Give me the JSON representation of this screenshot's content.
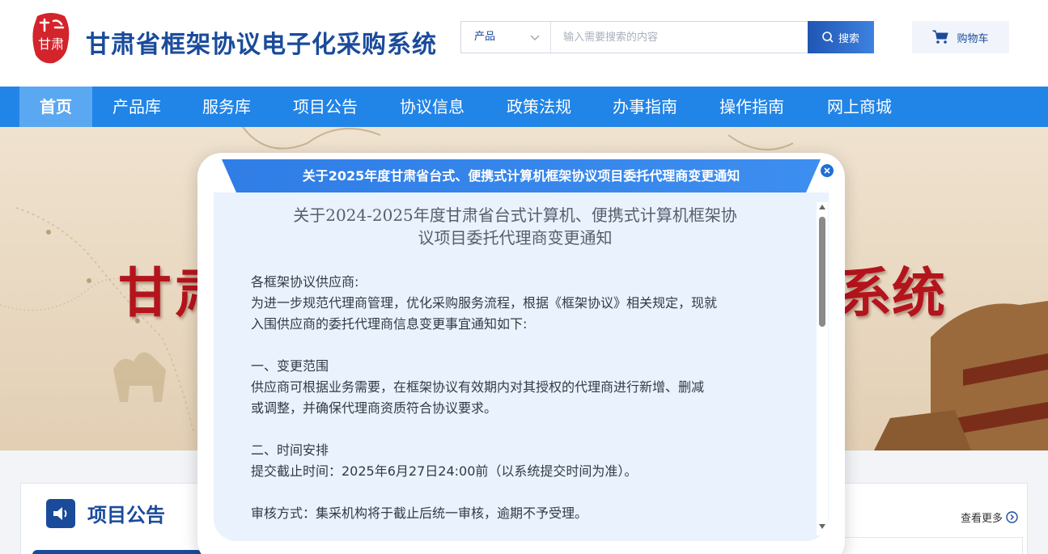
{
  "header": {
    "logo_text": "甘肃",
    "site_title": "甘肃省框架协议电子化采购系统",
    "search": {
      "category": "产品",
      "placeholder": "输入需要搜索的内容",
      "button_label": "搜索"
    },
    "cart_label": "购物车"
  },
  "nav": {
    "items": [
      {
        "label": "首页",
        "active": true
      },
      {
        "label": "产品库"
      },
      {
        "label": "服务库"
      },
      {
        "label": "项目公告"
      },
      {
        "label": "协议信息"
      },
      {
        "label": "政策法规"
      },
      {
        "label": "办事指南"
      },
      {
        "label": "操作指南"
      },
      {
        "label": "网上商城"
      }
    ]
  },
  "banner": {
    "title_left": "甘肃",
    "title_right": "系统"
  },
  "modal": {
    "header_title": "关于2025年度甘肃省台式、便携式计算机框架协议项目委托代理商变更通知",
    "doc_title_line1": "关于2024-2025年度甘肃省台式计算机、便携式计算机框架协",
    "doc_title_line2": "议项目委托代理商变更通知",
    "paragraphs": [
      "各框架协议供应商:",
      "为进一步规范代理商管理，优化采购服务流程，根据《框架协议》相关规定，现就",
      "入围供应商的委托代理商信息变更事宜通知如下:",
      "一、变更范围",
      " 供应商可根据业务需要，在框架协议有效期内对其授权的代理商进行新增、删减",
      "或调整，并确保代理商资质符合协议要求。",
      "二、时间安排",
      " 提交截止时间：2025年6月27日24:00前（以系统提交时间为准）。",
      " 审核方式：集采机构将于截止后统一审核，逾期不予受理。"
    ]
  },
  "section": {
    "title": "项目公告",
    "more_label": "查看更多"
  },
  "colors": {
    "brand_blue": "#1a4b9b",
    "nav_blue": "#2184e7",
    "nav_active": "#5aa7f2",
    "banner_red": "#b4141c"
  }
}
